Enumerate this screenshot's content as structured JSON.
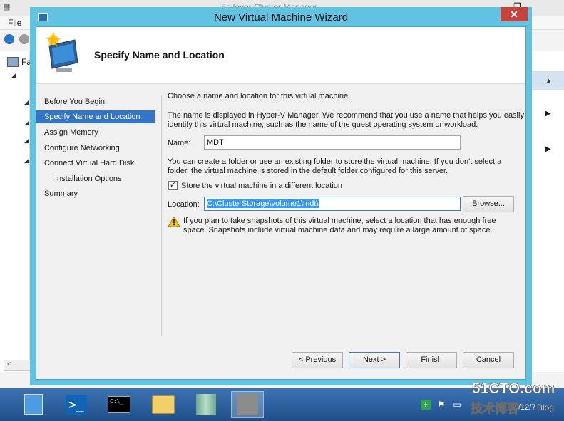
{
  "background_app": {
    "title": "Failover Cluster Manager",
    "menu_file": "File",
    "tree_label": "Fa"
  },
  "wizard": {
    "title": "New Virtual Machine Wizard",
    "close_glyph": "✕",
    "header_title": "Specify Name and Location",
    "steps": [
      {
        "label": "Before You Begin"
      },
      {
        "label": "Specify Name and Location"
      },
      {
        "label": "Assign Memory"
      },
      {
        "label": "Configure Networking"
      },
      {
        "label": "Connect Virtual Hard Disk"
      },
      {
        "label": "Installation Options"
      },
      {
        "label": "Summary"
      }
    ],
    "intro_text": "Choose a name and location for this virtual machine.",
    "name_help_line1": "The name is displayed in Hyper-V Manager. We recommend that you use a name that helps you easily",
    "name_help_line2": "identify this virtual machine, such as the name of the guest operating system or workload.",
    "name_label": "Name:",
    "name_value": "MDT",
    "folder_help_line1": "You can create a folder or use an existing folder to store the virtual machine. If you don't select a",
    "folder_help_line2": "folder, the virtual machine is stored in the default folder configured for this server.",
    "store_checkbox_label": "Store the virtual machine in a different location",
    "store_checkbox_checked": true,
    "location_label": "Location:",
    "location_value": "C:\\ClusterStorage\\volume1\\mdt\\",
    "browse_button": "Browse...",
    "warning_line1": "If you plan to take snapshots of this virtual machine, select a location that has enough free",
    "warning_line2": "space. Snapshots include virtual machine data and may require a large amount of space.",
    "previous_button": "< Previous",
    "next_button": "Next >",
    "finish_button": "Finish",
    "cancel_button": "Cancel"
  },
  "taskbar": {
    "clock": "/12/7",
    "ps_glyph": ">_",
    "cmd_text": "C:\\_"
  },
  "watermark": {
    "line1": "51CTO.com",
    "line2": "技术博客",
    "line3": "Blog"
  }
}
